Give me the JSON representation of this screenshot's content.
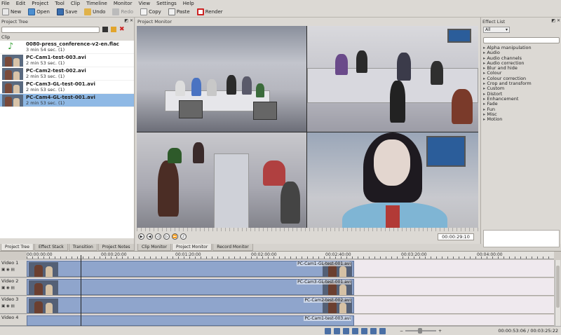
{
  "menu": [
    "File",
    "Edit",
    "Project",
    "Tool",
    "Clip",
    "Timeline",
    "Monitor",
    "View",
    "Settings",
    "Help"
  ],
  "toolbar": {
    "new": "New",
    "open": "Open",
    "save": "Save",
    "undo": "Undo",
    "redo": "Redo",
    "copy": "Copy",
    "paste": "Paste",
    "render": "Render"
  },
  "project_tree": {
    "title": "Project Tree",
    "clip_header": "Clip",
    "clips": [
      {
        "name": "0080-press_conference-v2-en.flac",
        "duration": "3 min 54 sec. (1)",
        "type": "audio"
      },
      {
        "name": "PC-Cam1-test-003.avi",
        "duration": "2 min 53 sec. (1)",
        "type": "video"
      },
      {
        "name": "PC-Cam2-test-002.avi",
        "duration": "2 min 53 sec. (1)",
        "type": "video"
      },
      {
        "name": "PC-Cam3-GL-test-001.avi",
        "duration": "2 min 53 sec. (1)",
        "type": "video"
      },
      {
        "name": "PC-Cam4-GL-test-001.avi",
        "duration": "2 min 53 sec. (1)",
        "type": "video"
      }
    ],
    "tabs": [
      "Project Tree",
      "Effect Stack",
      "Transition",
      "Project Notes"
    ]
  },
  "monitor": {
    "title": "Project Monitor",
    "timecode": "00:00:29:10",
    "tabs": [
      "Clip Monitor",
      "Project Monitor",
      "Record Monitor"
    ]
  },
  "effects": {
    "title": "Effect List",
    "filter": "All",
    "categories": [
      "Alpha manipulation",
      "Audio",
      "Audio channels",
      "Audio correction",
      "Blur and hide",
      "Colour",
      "Colour correction",
      "Crop and transform",
      "Custom",
      "Distort",
      "Enhancement",
      "Fade",
      "Fun",
      "Misc",
      "Motion"
    ]
  },
  "timeline": {
    "ruler_marks": [
      "00:00:00:00",
      "00:00:20:00",
      "00:01:20:00",
      "00:02:00:00",
      "00:02:40:00",
      "00:03:20:00",
      "00:04:00:00"
    ],
    "tracks": [
      {
        "name": "Video 1",
        "clip": "PC-Cam1-GL-test-001.avi"
      },
      {
        "name": "Video 2",
        "clip": "PC-Cam3-GL-test-001.avi"
      },
      {
        "name": "Video 3",
        "clip": "PC-Cam2-test-002.avi"
      },
      {
        "name": "Video 4",
        "clip": "PC-Cam1-test-003.avi"
      }
    ],
    "position_timecode": "00:00:53:06",
    "duration_timecode": "00:03:25:22",
    "timecode_separator": "/"
  },
  "colors": {
    "selection": "#8fb9e5",
    "clip_fill": "#8fa5cc",
    "render_red": "#cc2222"
  }
}
